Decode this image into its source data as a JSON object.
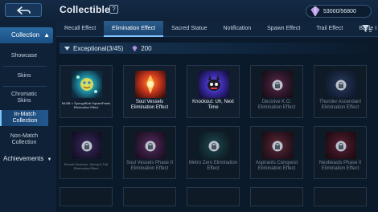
{
  "header": {
    "title": "Collectible",
    "help_label": "?",
    "currency": "53000/56800"
  },
  "tabs": [
    {
      "label": "Recall Effect",
      "active": false
    },
    {
      "label": "Elimination Effect",
      "active": true
    },
    {
      "label": "Sacred Statue",
      "active": false
    },
    {
      "label": "Notification",
      "active": false
    },
    {
      "label": "Spawn Effect",
      "active": false
    },
    {
      "label": "Trail Effect",
      "active": false
    },
    {
      "label": "Battle I",
      "active": false
    }
  ],
  "sidebar": {
    "head": "Collection",
    "items": [
      {
        "label": "Showcase",
        "active": false
      },
      {
        "label": "Skins",
        "active": false
      },
      {
        "label": "Chromatic Skins",
        "active": false
      },
      {
        "label": "In-Match Collection",
        "active": true
      },
      {
        "label": "Non-Match Collection",
        "active": false
      }
    ],
    "achievements": "Achievements"
  },
  "section": {
    "title": "Exceptional(3/45)",
    "points": "200"
  },
  "cards": [
    {
      "label": "MLBB × SpongeBob SquarePants Elimination Effect",
      "locked": false
    },
    {
      "label": "Soul Vessels Elimination Effect",
      "locked": false
    },
    {
      "label": "Knockout: Uh, Next Time",
      "locked": false
    },
    {
      "label": "Decisive K.O. Elimination Effect",
      "locked": true
    },
    {
      "label": "Thunder Ascendant Elimination Effect",
      "locked": true
    },
    {
      "label": "Eternal Seasons: Spring & Fall Elimination Effect",
      "locked": true
    },
    {
      "label": "Soul Vessels Phase II Elimination Effect",
      "locked": true
    },
    {
      "label": "Metro Zero Elimination Effect",
      "locked": true
    },
    {
      "label": "Aspirants Conquest Elimination Effect",
      "locked": true
    },
    {
      "label": "Neobeasts Phase II Elimination Effect",
      "locked": true
    }
  ],
  "colors": {
    "accent": "#7fc4ff",
    "active_tab": "#2a5d8c",
    "background": "#0c1b2e"
  }
}
